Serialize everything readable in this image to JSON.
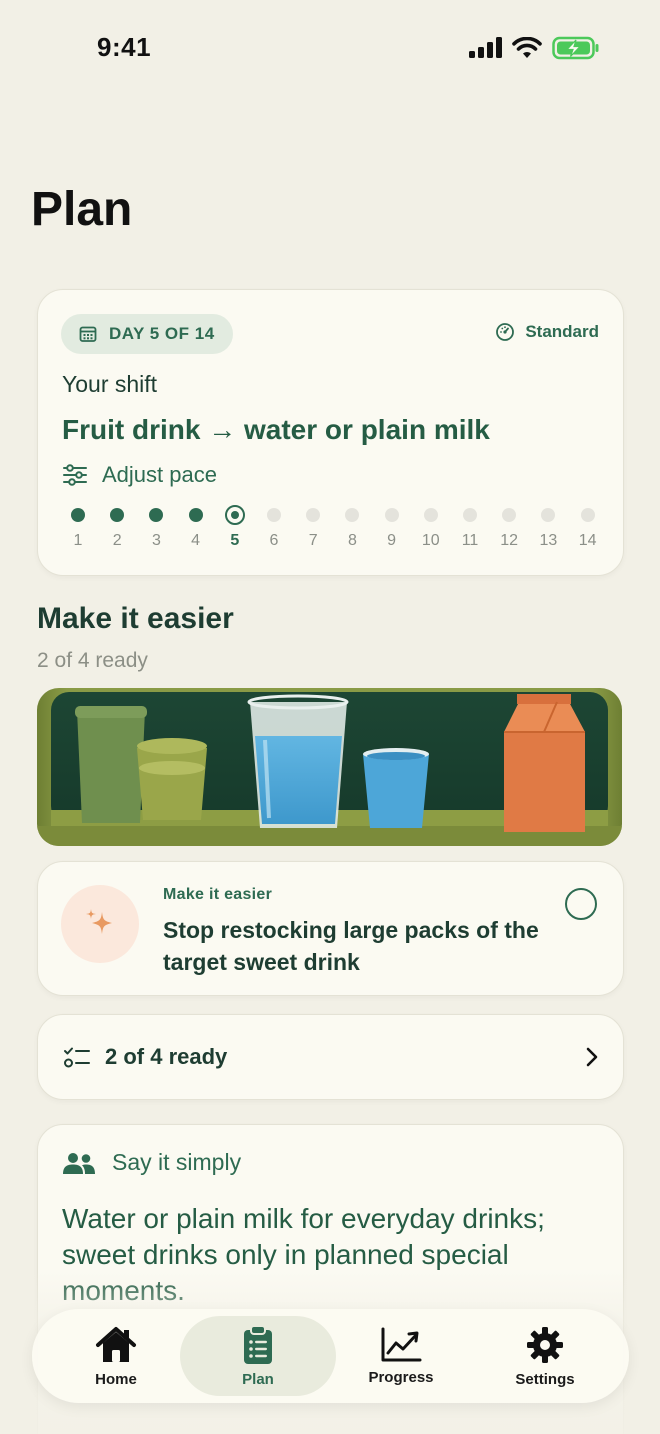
{
  "status": {
    "time": "9:41"
  },
  "page": {
    "title": "Plan"
  },
  "shift": {
    "day_label": "DAY 5 OF 14",
    "pace": "Standard",
    "label": "Your shift",
    "headline": "Fruit drink → water or plain milk",
    "adjust_label": "Adjust pace",
    "days": [
      "1",
      "2",
      "3",
      "4",
      "5",
      "6",
      "7",
      "8",
      "9",
      "10",
      "11",
      "12",
      "13",
      "14"
    ],
    "current_day": 5,
    "total_days": 14
  },
  "easier": {
    "title": "Make it easier",
    "subtitle": "2 of 4 ready"
  },
  "tip": {
    "eyebrow": "Make it easier",
    "text": "Stop restocking large packs of the target sweet drink",
    "checked": false
  },
  "ready_row": {
    "label": "2 of 4 ready"
  },
  "say": {
    "heading": "Say it simply",
    "text": "Water or plain milk for everyday drinks; sweet drinks only in planned special moments."
  },
  "tabs": [
    {
      "label": "Home",
      "icon": "house-icon"
    },
    {
      "label": "Plan",
      "icon": "clipboard-icon",
      "active": true
    },
    {
      "label": "Progress",
      "icon": "chart-line-icon"
    },
    {
      "label": "Settings",
      "icon": "gear-icon"
    }
  ],
  "colors": {
    "accent": "#2e6b52",
    "background": "#f2f0e6",
    "card": "#fbfaf2",
    "tip_icon_bg": "#fbe8dc",
    "tip_icon": "#e89a62"
  }
}
